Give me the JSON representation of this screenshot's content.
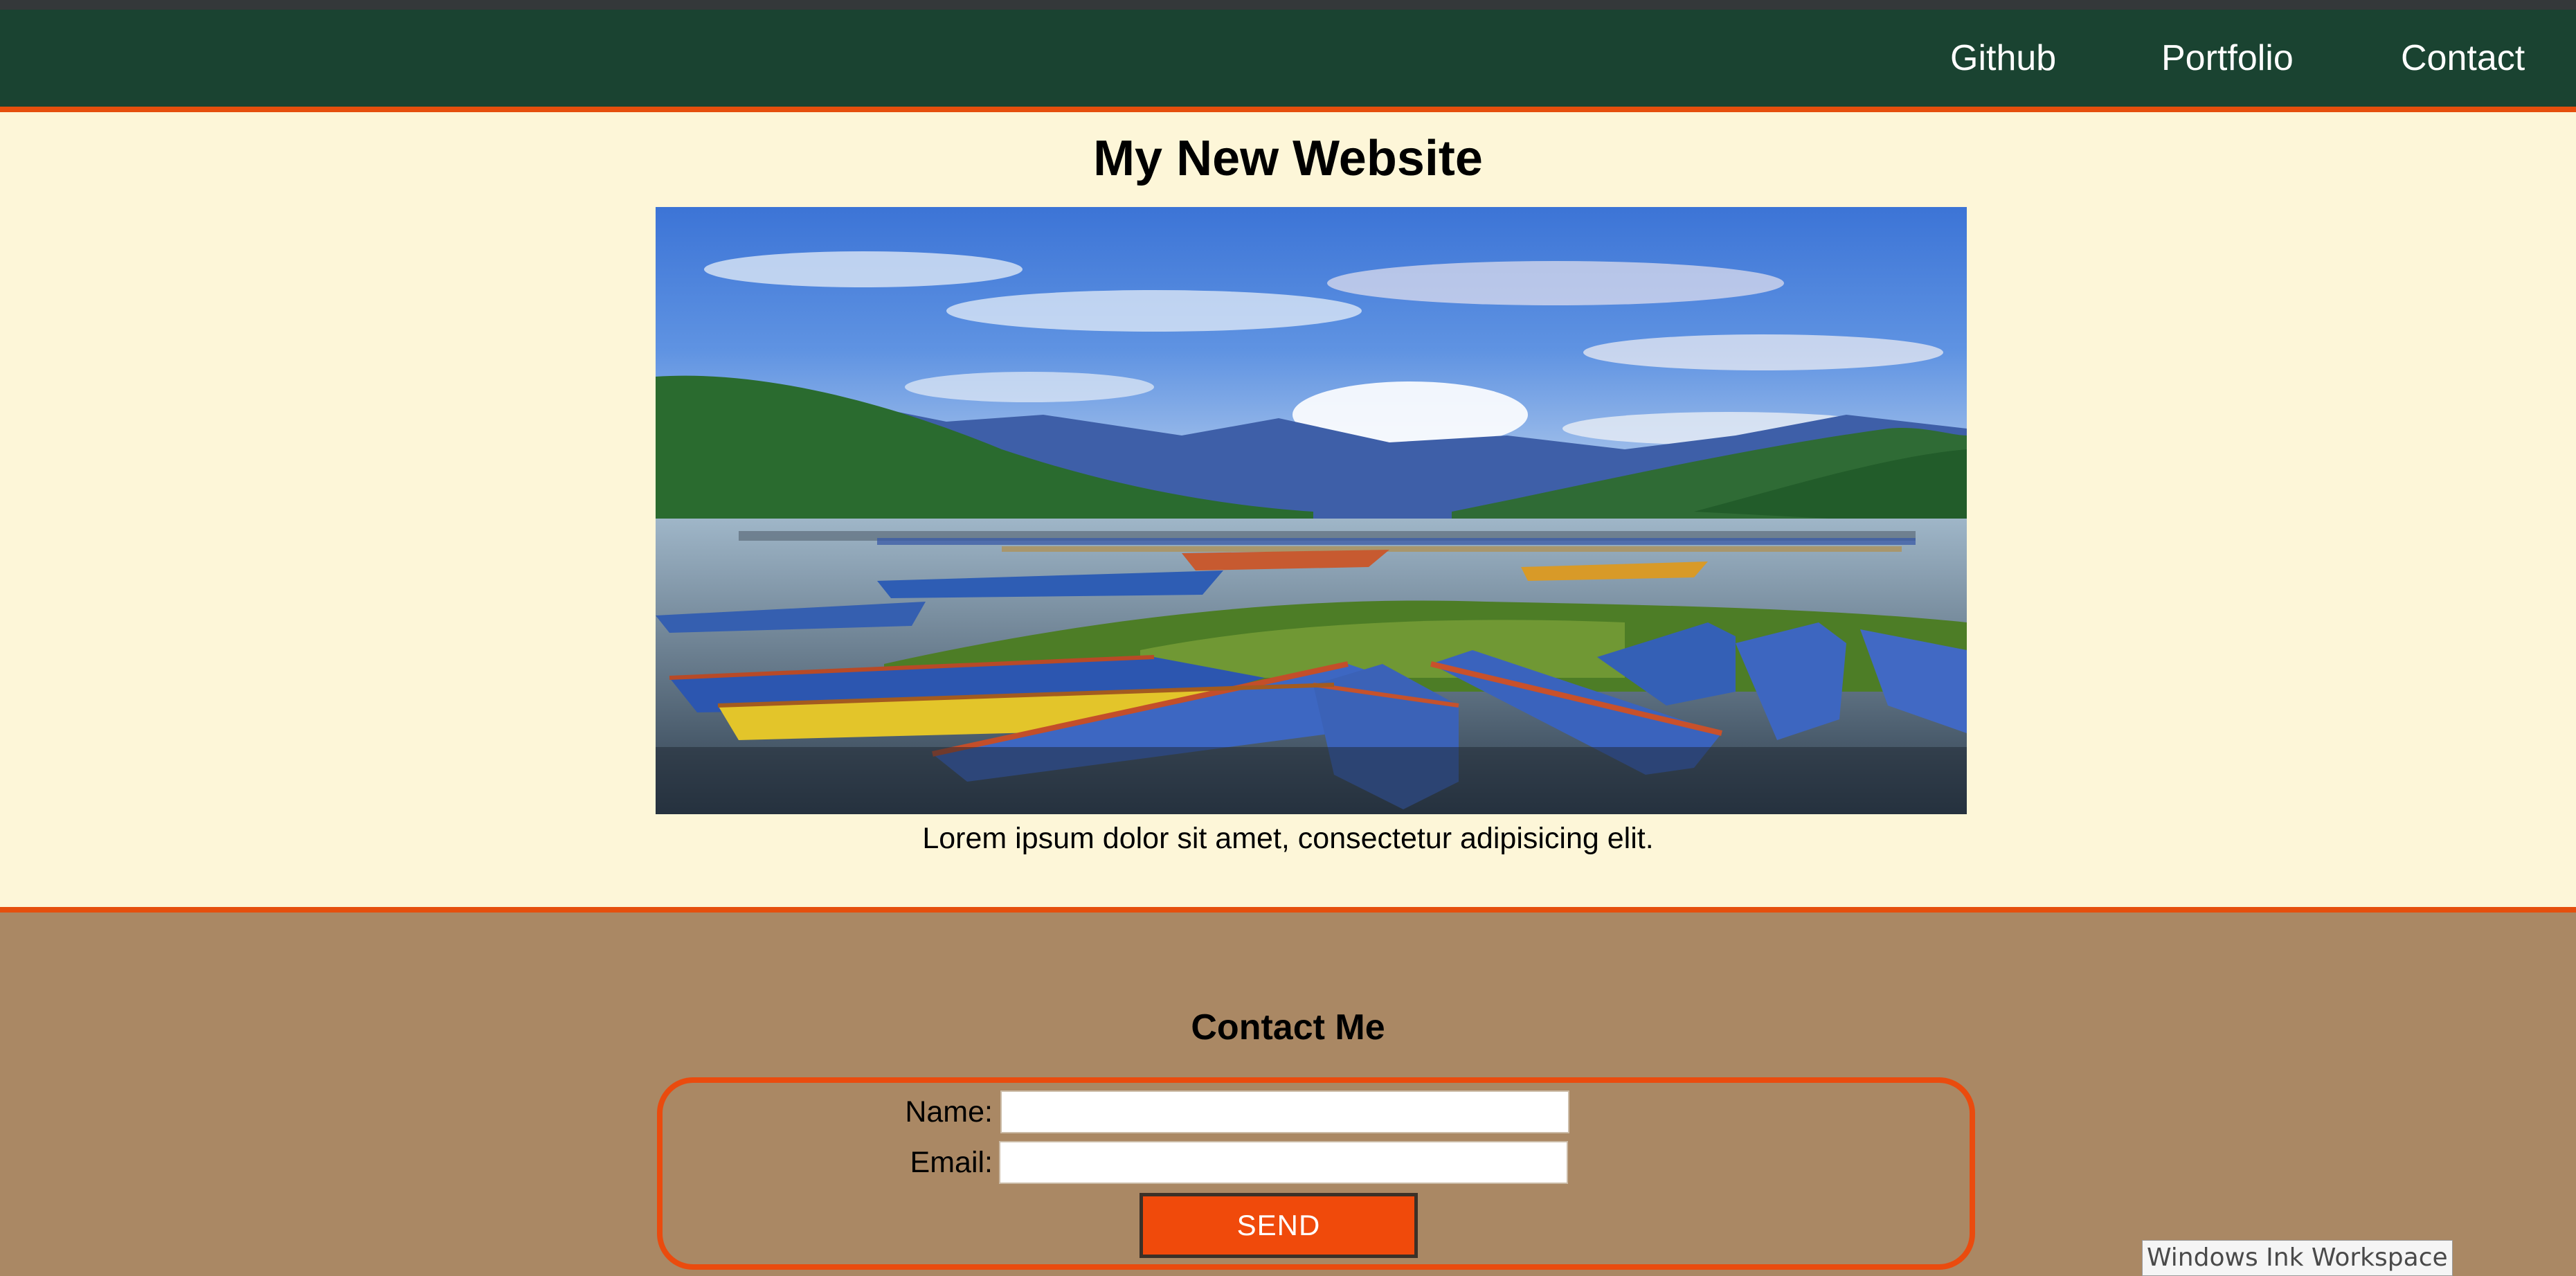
{
  "nav": {
    "links": [
      {
        "label": "Github"
      },
      {
        "label": "Portfolio"
      },
      {
        "label": "Contact"
      }
    ]
  },
  "hero": {
    "title": "My New Website",
    "image_alt": "lake-with-colorful-boats-photo",
    "caption": "Lorem ipsum dolor sit amet, consectetur adipisicing elit."
  },
  "contact": {
    "title": "Contact Me",
    "name_label": "Name:",
    "name_value": "",
    "email_label": "Email:",
    "email_value": "",
    "send_label": "SEND"
  },
  "system": {
    "tooltip": "Windows Ink Workspace"
  },
  "colors": {
    "nav_bg": "#1a4331",
    "accent": "#e54f0d",
    "hero_bg": "#fdf6d8",
    "contact_bg": "#aa8864",
    "button_bg": "#f04a0b"
  }
}
